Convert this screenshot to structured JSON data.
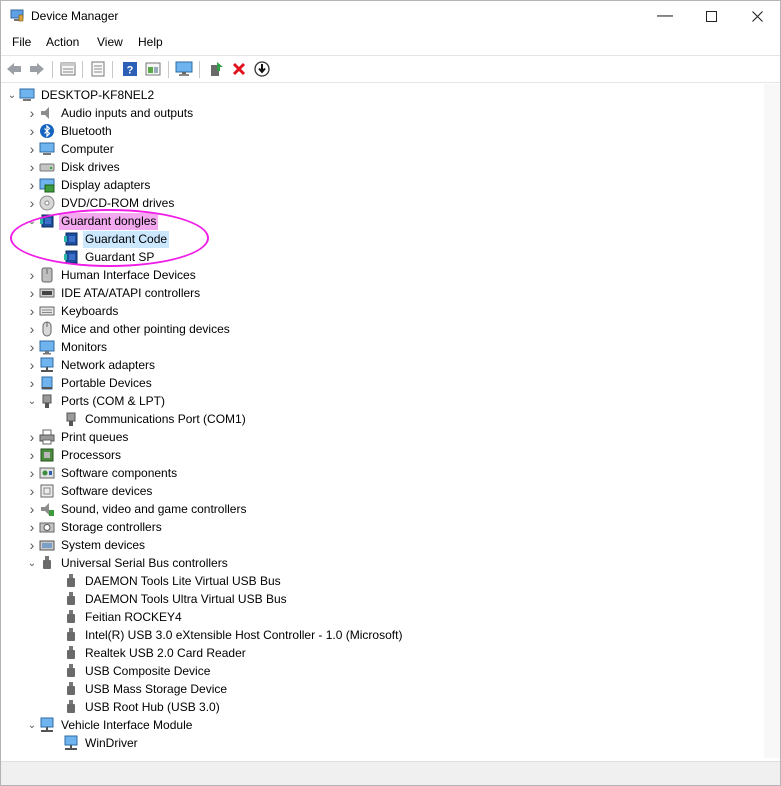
{
  "window": {
    "title": "Device Manager"
  },
  "menu": [
    "File",
    "Action",
    "View",
    "Help"
  ],
  "toolbar": {
    "buttons": [
      "back-icon",
      "forward-icon",
      "properties-icon",
      "list-icon",
      "help-icon",
      "update-icon",
      "monitor-icon",
      "enable-device-icon",
      "uninstall-icon",
      "download-icon"
    ]
  },
  "tree": {
    "root": "DESKTOP-KF8NEL2",
    "items": [
      {
        "label": "Audio inputs and outputs",
        "icon": "speaker-icon",
        "level": 1,
        "expanded": false
      },
      {
        "label": "Bluetooth",
        "icon": "bluetooth-icon",
        "level": 1,
        "expanded": false
      },
      {
        "label": "Computer",
        "icon": "computer-icon",
        "level": 1,
        "expanded": false
      },
      {
        "label": "Disk drives",
        "icon": "disk-icon",
        "level": 1,
        "expanded": false
      },
      {
        "label": "Display adapters",
        "icon": "display-adapter-icon",
        "level": 1,
        "expanded": false
      },
      {
        "label": "DVD/CD-ROM drives",
        "icon": "dvd-icon",
        "level": 1,
        "expanded": false
      },
      {
        "label": "Guardant dongles",
        "icon": "dongle-icon",
        "level": 1,
        "expanded": true,
        "highlight": "pink"
      },
      {
        "label": "Guardant Code",
        "icon": "dongle-icon",
        "level": 2,
        "highlight": "blue"
      },
      {
        "label": "Guardant SP",
        "icon": "dongle-icon",
        "level": 2
      },
      {
        "label": "Human Interface Devices",
        "icon": "hid-icon",
        "level": 1,
        "expanded": false
      },
      {
        "label": "IDE ATA/ATAPI controllers",
        "icon": "ide-icon",
        "level": 1,
        "expanded": false
      },
      {
        "label": "Keyboards",
        "icon": "keyboard-icon",
        "level": 1,
        "expanded": false
      },
      {
        "label": "Mice and other pointing devices",
        "icon": "mouse-icon",
        "level": 1,
        "expanded": false
      },
      {
        "label": "Monitors",
        "icon": "monitor-icon",
        "level": 1,
        "expanded": false
      },
      {
        "label": "Network adapters",
        "icon": "network-icon",
        "level": 1,
        "expanded": false
      },
      {
        "label": "Portable Devices",
        "icon": "portable-icon",
        "level": 1,
        "expanded": false
      },
      {
        "label": "Ports (COM & LPT)",
        "icon": "port-icon",
        "level": 1,
        "expanded": true
      },
      {
        "label": "Communications Port (COM1)",
        "icon": "port-icon",
        "level": 2
      },
      {
        "label": "Print queues",
        "icon": "printer-icon",
        "level": 1,
        "expanded": false
      },
      {
        "label": "Processors",
        "icon": "processor-icon",
        "level": 1,
        "expanded": false
      },
      {
        "label": "Software components",
        "icon": "software-component-icon",
        "level": 1,
        "expanded": false
      },
      {
        "label": "Software devices",
        "icon": "software-device-icon",
        "level": 1,
        "expanded": false
      },
      {
        "label": "Sound, video and game controllers",
        "icon": "sound-icon",
        "level": 1,
        "expanded": false
      },
      {
        "label": "Storage controllers",
        "icon": "storage-icon",
        "level": 1,
        "expanded": false
      },
      {
        "label": "System devices",
        "icon": "system-icon",
        "level": 1,
        "expanded": false
      },
      {
        "label": "Universal Serial Bus controllers",
        "icon": "usb-icon",
        "level": 1,
        "expanded": true
      },
      {
        "label": "DAEMON Tools Lite Virtual USB Bus",
        "icon": "usb-icon",
        "level": 2
      },
      {
        "label": "DAEMON Tools Ultra Virtual USB Bus",
        "icon": "usb-icon",
        "level": 2
      },
      {
        "label": "Feitian ROCKEY4",
        "icon": "usb-icon",
        "level": 2
      },
      {
        "label": "Intel(R) USB 3.0 eXtensible Host Controller - 1.0 (Microsoft)",
        "icon": "usb-icon",
        "level": 2
      },
      {
        "label": "Realtek USB 2.0 Card Reader",
        "icon": "usb-icon",
        "level": 2
      },
      {
        "label": "USB Composite Device",
        "icon": "usb-icon",
        "level": 2
      },
      {
        "label": "USB Mass Storage Device",
        "icon": "usb-icon",
        "level": 2
      },
      {
        "label": "USB Root Hub (USB 3.0)",
        "icon": "usb-icon",
        "level": 2
      },
      {
        "label": "Vehicle Interface Module",
        "icon": "network-icon",
        "level": 1,
        "expanded": true
      },
      {
        "label": "WinDriver",
        "icon": "network-icon",
        "level": 2
      }
    ]
  },
  "colors": {
    "highlight_pink": "#f3a8ef",
    "highlight_blue": "#cce8ff",
    "annotation": "#f01ee6",
    "accent": "#1e6fd9"
  }
}
